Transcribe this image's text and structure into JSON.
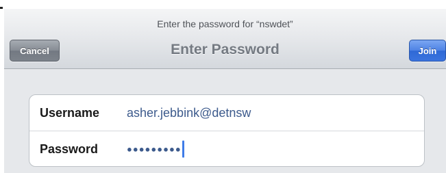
{
  "navbar": {
    "prompt": "Enter the password for “nswdet”",
    "title": "Enter Password",
    "cancel_label": "Cancel",
    "join_label": "Join"
  },
  "form": {
    "username_label": "Username",
    "username_value": "asher.jebbink@detnsw",
    "password_label": "Password",
    "password_masked": "●●●●●●●●●"
  },
  "colors": {
    "join_button": "#3a73de",
    "cancel_button": "#7c828a",
    "value_text": "#3c5a8c",
    "caret": "#3f7ce8"
  }
}
